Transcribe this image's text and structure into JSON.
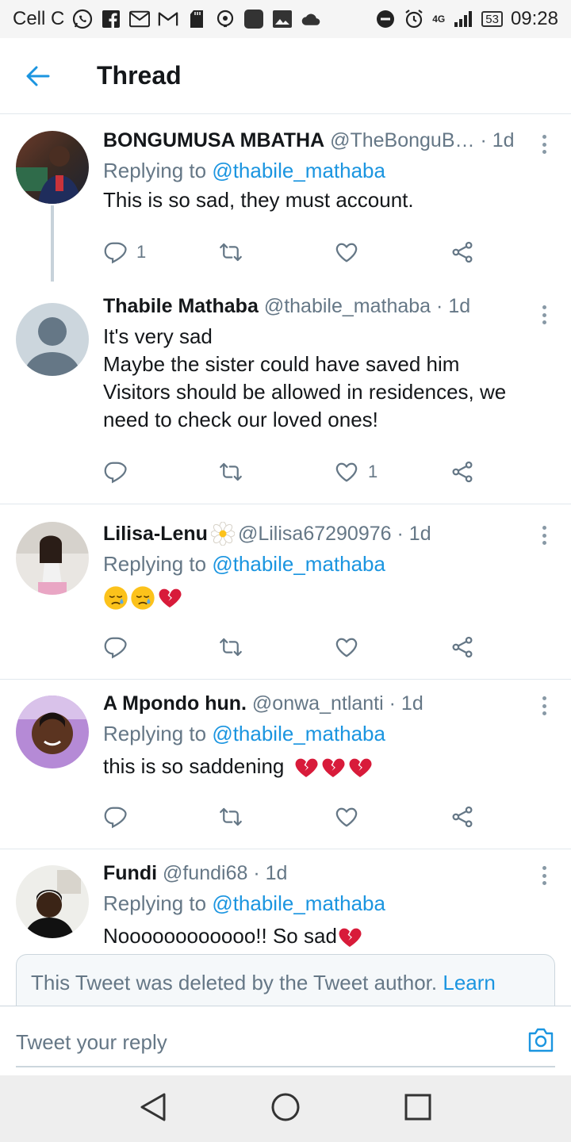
{
  "status_bar": {
    "carrier": "Cell C",
    "network": "4G",
    "battery": "53",
    "time": "09:28"
  },
  "header": {
    "title": "Thread",
    "back_icon": "arrow-left-icon"
  },
  "colors": {
    "accent": "#1b95e0",
    "secondary_text": "#657786",
    "divider": "#e1e8ed",
    "heart_red": "#e0245e"
  },
  "tweets": [
    {
      "name": "BONGUMUSA MBATHA",
      "handle": "@TheBonguB…",
      "dot": "·",
      "time": "1d",
      "reply_prefix": "Replying to ",
      "reply_to": "@thabile_mathaba",
      "text": "This is so sad, they must account.",
      "reply_count": "1",
      "retweet_count": "",
      "like_count": ""
    },
    {
      "name": "Thabile Mathaba",
      "handle": "@thabile_mathaba",
      "dot": "·",
      "time": "1d",
      "text_lines": [
        "It's very sad",
        "Maybe the sister could have saved him",
        "Visitors should be allowed in residences, we",
        "need to check our loved ones!"
      ],
      "reply_count": "",
      "retweet_count": "",
      "like_count": "1"
    },
    {
      "name": "Lilisa-Lenu",
      "handle": "@Lilisa67290976",
      "dot": "·",
      "time": "1d",
      "reply_prefix": "Replying to ",
      "reply_to": "@thabile_mathaba",
      "text": "",
      "emojis": [
        "sad-face-icon",
        "sad-face-icon",
        "broken-heart-icon"
      ]
    },
    {
      "name": "A Mpondo hun.",
      "handle": "@onwa_ntlanti",
      "dot": "·",
      "time": "1d",
      "reply_prefix": "Replying to ",
      "reply_to": "@thabile_mathaba",
      "text": "this is so saddening",
      "emojis": [
        "broken-heart-icon",
        "broken-heart-icon",
        "broken-heart-icon"
      ]
    },
    {
      "name": "Fundi",
      "handle": "@fundi68",
      "dot": "·",
      "time": "1d",
      "reply_prefix": "Replying to ",
      "reply_to": "@thabile_mathaba",
      "text": "Noooooooooooo!! So sad",
      "emojis": [
        "broken-heart-icon"
      ]
    }
  ],
  "deleted_notice": {
    "text": "This Tweet was deleted by the Tweet author.",
    "link": "Learn"
  },
  "composer": {
    "placeholder": "Tweet your reply",
    "camera_icon": "camera-icon"
  },
  "nav": {
    "back": "nav-back-icon",
    "home": "nav-home-icon",
    "recents": "nav-recents-icon"
  }
}
